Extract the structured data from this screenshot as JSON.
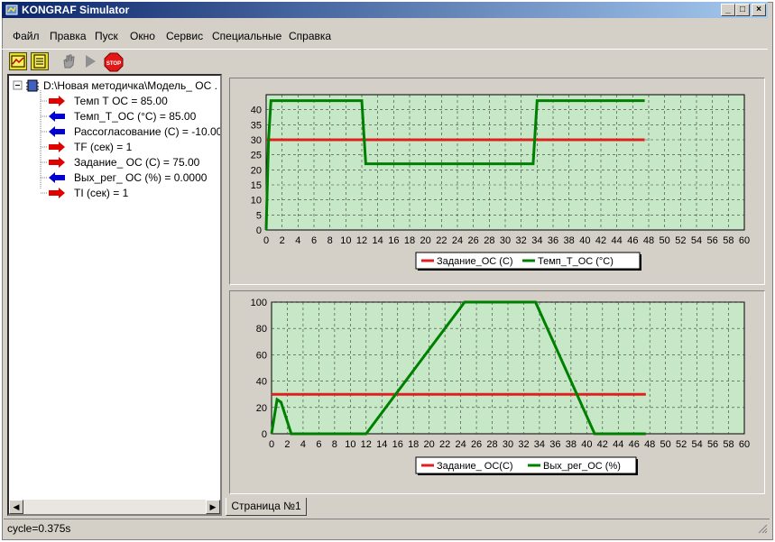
{
  "window": {
    "title": "KONGRAF Simulator"
  },
  "menu": [
    "Файл",
    "Правка",
    "Пуск",
    "Окно",
    "Сервис",
    "Специальные",
    "Справка"
  ],
  "toolbar": {
    "stop_label": "STOP"
  },
  "tree": {
    "root": "D:\\Новая методичка\\Модель_ ОС .",
    "items": [
      {
        "label": "Темп Т ОС = 85.00",
        "dir": "out",
        "color": "#e00000"
      },
      {
        "label": "Темп_Т_ОС  (°С) = 85.00",
        "dir": "in",
        "color": "#0000d0"
      },
      {
        "label": "Рассогласование (С) = -10.00",
        "dir": "in",
        "color": "#0000d0"
      },
      {
        "label": "TF (сек) = 1",
        "dir": "out",
        "color": "#e00000"
      },
      {
        "label": "Задание_ ОС (С) = 75.00",
        "dir": "out",
        "color": "#e00000"
      },
      {
        "label": "Вых_рег_ ОС (%) = 0.0000",
        "dir": "in",
        "color": "#0000d0"
      },
      {
        "label": "TI (сек) = 1",
        "dir": "out",
        "color": "#e00000"
      }
    ]
  },
  "tab": {
    "label": "Страница №1"
  },
  "status": {
    "text": "cycle=0.375s"
  },
  "chart_data": [
    {
      "type": "line",
      "xlim": [
        0,
        60
      ],
      "ylim": [
        0,
        45
      ],
      "xticks": [
        0,
        2,
        4,
        6,
        8,
        10,
        12,
        14,
        16,
        18,
        20,
        22,
        24,
        26,
        28,
        30,
        32,
        34,
        36,
        38,
        40,
        42,
        44,
        46,
        48,
        50,
        52,
        54,
        56,
        58,
        60
      ],
      "yticks": [
        0,
        5,
        10,
        15,
        20,
        25,
        30,
        35,
        40
      ],
      "grid": true,
      "legend_position": "bottom",
      "series": [
        {
          "name": "Задание_ОС (С)",
          "color": "#e02020",
          "points": [
            [
              0,
              30
            ],
            [
              47.5,
              30
            ]
          ]
        },
        {
          "name": "Темп_Т_ОС (°С)",
          "color": "#008000",
          "points": [
            [
              0,
              0
            ],
            [
              0.3,
              30
            ],
            [
              0.6,
              43
            ],
            [
              12,
              43
            ],
            [
              12.5,
              22
            ],
            [
              33.5,
              22
            ],
            [
              34,
              43
            ],
            [
              47.5,
              43
            ]
          ]
        }
      ]
    },
    {
      "type": "line",
      "xlim": [
        0,
        60
      ],
      "ylim": [
        0,
        100
      ],
      "xticks": [
        0,
        2,
        4,
        6,
        8,
        10,
        12,
        14,
        16,
        18,
        20,
        22,
        24,
        26,
        28,
        30,
        32,
        34,
        36,
        38,
        40,
        42,
        44,
        46,
        48,
        50,
        52,
        54,
        56,
        58,
        60
      ],
      "yticks": [
        0,
        20,
        40,
        60,
        80,
        100
      ],
      "grid": true,
      "legend_position": "bottom",
      "series": [
        {
          "name": "Задание_ ОС(С)",
          "color": "#e02020",
          "points": [
            [
              0,
              30
            ],
            [
              47.5,
              30
            ]
          ]
        },
        {
          "name": "Вых_рег_ОС  (%)",
          "color": "#008000",
          "points": [
            [
              0,
              0
            ],
            [
              0.7,
              26
            ],
            [
              1.2,
              24
            ],
            [
              2.5,
              0
            ],
            [
              12,
              0
            ],
            [
              24.5,
              100
            ],
            [
              33.5,
              100
            ],
            [
              41,
              0
            ],
            [
              47.5,
              0
            ]
          ]
        }
      ]
    }
  ]
}
